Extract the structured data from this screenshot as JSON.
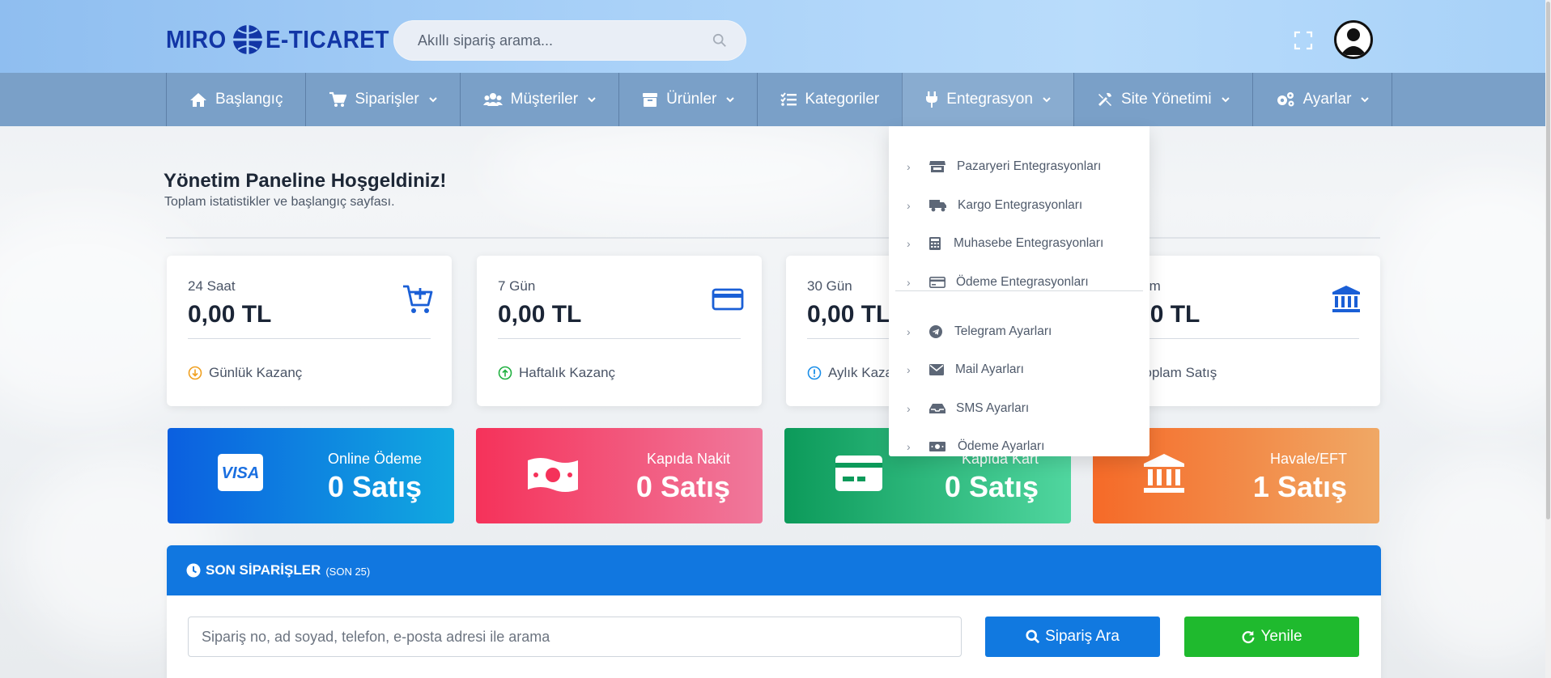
{
  "header": {
    "logo_left": "MIRO",
    "logo_right": "E-TICARET",
    "search_placeholder": "Akıllı sipariş arama..."
  },
  "nav": {
    "items": [
      {
        "label": "Başlangıç",
        "icon": "home-icon",
        "has_caret": false
      },
      {
        "label": "Siparişler",
        "icon": "cart-icon",
        "has_caret": true
      },
      {
        "label": "Müşteriler",
        "icon": "users-icon",
        "has_caret": true
      },
      {
        "label": "Ürünler",
        "icon": "box-icon",
        "has_caret": true
      },
      {
        "label": "Kategoriler",
        "icon": "list-icon",
        "has_caret": false
      },
      {
        "label": "Entegrasyon",
        "icon": "plug-icon",
        "has_caret": true
      },
      {
        "label": "Site Yönetimi",
        "icon": "tools-icon",
        "has_caret": true
      },
      {
        "label": "Ayarlar",
        "icon": "gears-icon",
        "has_caret": true
      }
    ]
  },
  "page": {
    "title": "Yönetim Paneline Hoşgeldiniz!",
    "subtitle": "Toplam istatistikler ve başlangıç sayfası."
  },
  "stats": [
    {
      "label": "24 Saat",
      "value": "0,00 TL",
      "foot": "Günlük Kazanç",
      "icon": "cart-plus-icon",
      "foot_icon": "arrow-down-circle-icon",
      "foot_color": "#f0a020"
    },
    {
      "label": "7 Gün",
      "value": "0,00 TL",
      "foot": "Haftalık Kazanç",
      "icon": "credit-card-icon",
      "foot_icon": "arrow-up-circle-icon",
      "foot_color": "#20b040"
    },
    {
      "label": "30 Gün",
      "value": "0,00 TL",
      "foot": "Aylık Kazanç",
      "icon": "wallet-icon",
      "foot_icon": "info-circle-icon",
      "foot_color": "#1a8ee8"
    },
    {
      "label": "Toplam",
      "value": "0,00 TL",
      "foot": "Toplam Satış",
      "icon": "bank-icon",
      "foot_icon": "info-circle-icon",
      "foot_color": "#1a8ee8"
    }
  ],
  "payments": [
    {
      "title": "Online Ödeme",
      "value": "0 Satış",
      "icon": "visa-icon",
      "from": "#0b5fe0",
      "to": "#11a9e0"
    },
    {
      "title": "Kapıda Nakit",
      "value": "0 Satış",
      "icon": "money-bill-icon",
      "from": "#f5325a",
      "to": "#f0799c"
    },
    {
      "title": "Kapıda Kart",
      "value": "0 Satış",
      "icon": "card-icon",
      "from": "#0c9a5a",
      "to": "#50d69f"
    },
    {
      "title": "Havale/EFT",
      "value": "1 Satış",
      "icon": "bank-icon",
      "from": "#f56a28",
      "to": "#f0a865"
    }
  ],
  "orders": {
    "title": "SON SİPARİŞLER",
    "subtitle": "(SON 25)",
    "search_placeholder": "Sipariş no, ad soyad, telefon, e-posta adresi ile arama",
    "search_button": "Sipariş Ara",
    "refresh_button": "Yenile"
  },
  "dropdown": {
    "items": [
      {
        "label": "Pazaryeri Entegrasyonları",
        "icon": "store-icon"
      },
      {
        "label": "Kargo Entegrasyonları",
        "icon": "truck-icon"
      },
      {
        "label": "Muhasebe Entegrasyonları",
        "icon": "calculator-icon"
      },
      {
        "label": "Ödeme Entegrasyonları",
        "icon": "credit-card-icon"
      },
      {
        "label": "Telegram Ayarları",
        "icon": "telegram-icon"
      },
      {
        "label": "Mail Ayarları",
        "icon": "envelope-icon"
      },
      {
        "label": "SMS Ayarları",
        "icon": "inbox-icon"
      },
      {
        "label": "Ödeme Ayarları",
        "icon": "money-icon"
      }
    ]
  }
}
